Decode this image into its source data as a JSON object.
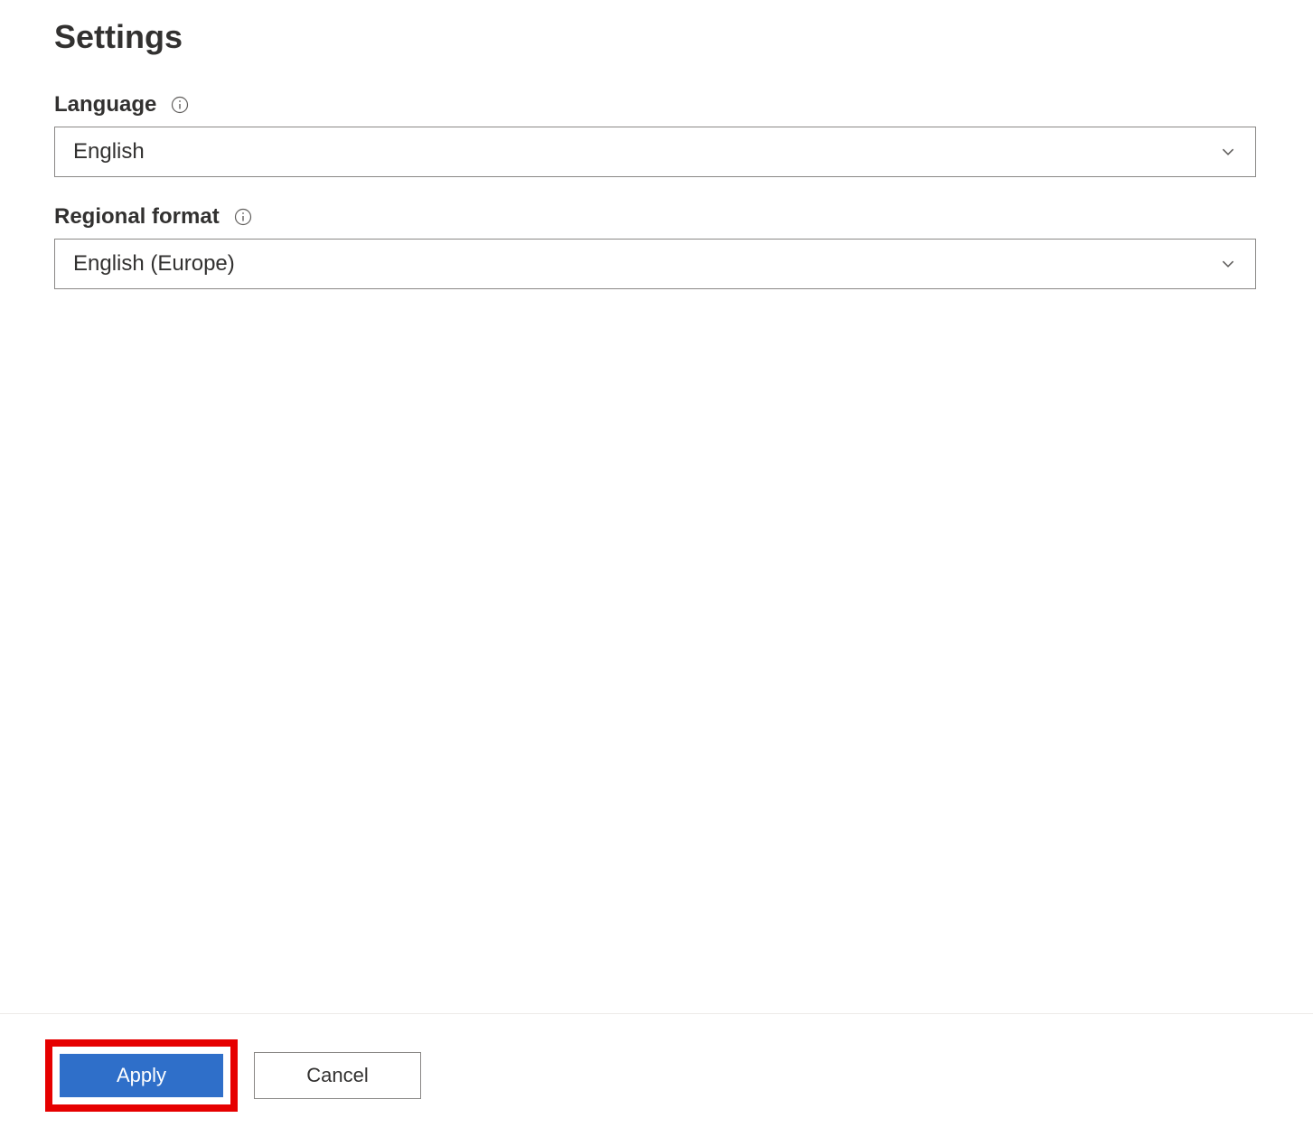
{
  "page": {
    "title": "Settings"
  },
  "fields": {
    "language": {
      "label": "Language",
      "value": "English"
    },
    "regionalFormat": {
      "label": "Regional format",
      "value": "English (Europe)"
    }
  },
  "footer": {
    "applyLabel": "Apply",
    "cancelLabel": "Cancel"
  }
}
